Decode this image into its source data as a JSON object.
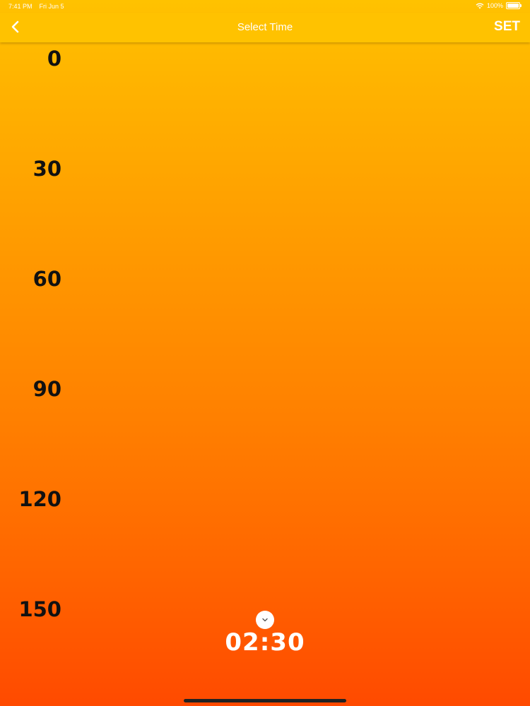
{
  "status_bar": {
    "time": "7:41 PM",
    "date": "Fri Jun 5",
    "battery": "100%",
    "wifi_icon": "wifi-icon",
    "battery_icon": "battery-icon"
  },
  "nav": {
    "back_icon": "chevron-left-icon",
    "title": "Select Time",
    "set_label": "SET",
    "background": "#FFC200"
  },
  "scale": {
    "labels": [
      "0",
      "30",
      "60",
      "90",
      "120",
      "150"
    ]
  },
  "selection": {
    "time": "02:30",
    "expand_icon": "chevron-down-icon"
  },
  "colors": {
    "gradient_top": "#FFC200",
    "gradient_bottom": "#FF4A00",
    "text_dark": "#111111",
    "text_light": "#ffffff"
  }
}
